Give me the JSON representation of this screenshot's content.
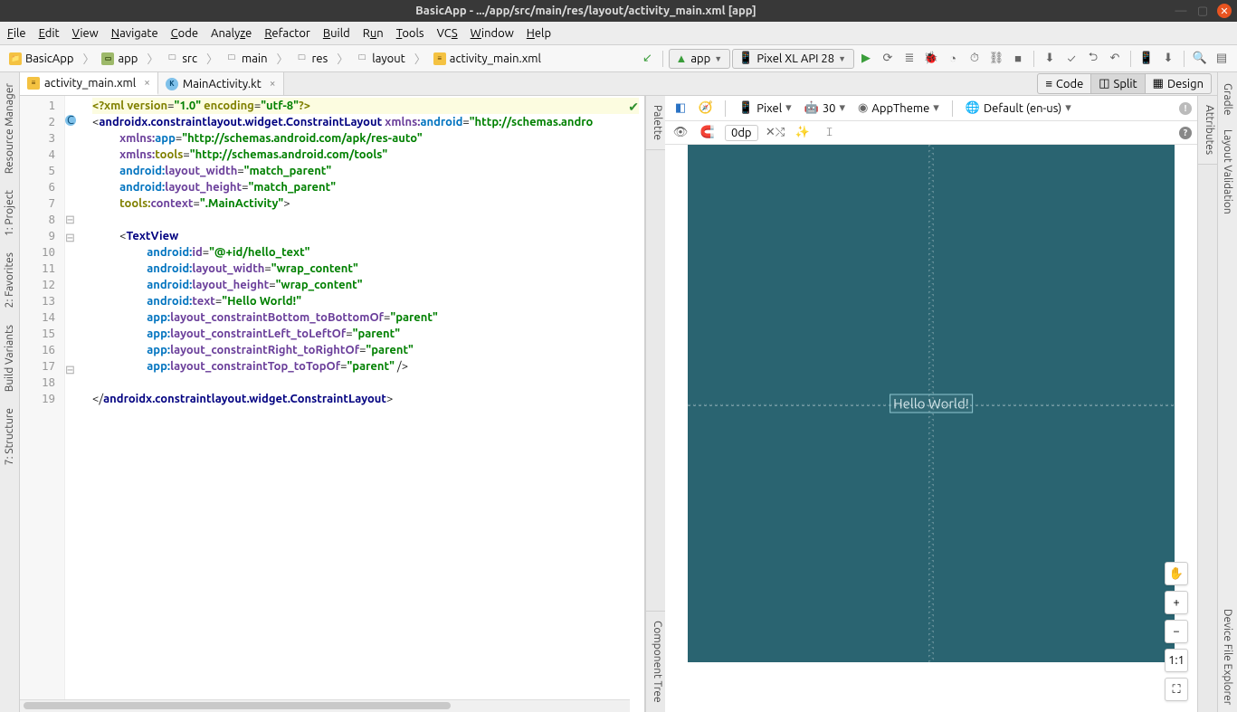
{
  "window": {
    "title": "BasicApp - .../app/src/main/res/layout/activity_main.xml [app]"
  },
  "menu": [
    "File",
    "Edit",
    "View",
    "Navigate",
    "Code",
    "Analyze",
    "Refactor",
    "Build",
    "Run",
    "Tools",
    "VCS",
    "Window",
    "Help"
  ],
  "breadcrumbs": [
    "BasicApp",
    "app",
    "src",
    "main",
    "res",
    "layout",
    "activity_main.xml"
  ],
  "run": {
    "config": "app",
    "device": "Pixel XL API 28"
  },
  "tabs": [
    {
      "label": "activity_main.xml",
      "icon": "xml",
      "active": true
    },
    {
      "label": "MainActivity.kt",
      "icon": "kt",
      "active": false
    }
  ],
  "view_modes": {
    "code": "Code",
    "split": "Split",
    "design": "Design",
    "active": "Split"
  },
  "left_tools": [
    "Resource Manager",
    "1: Project",
    "2: Favorites",
    "Build Variants",
    "7: Structure"
  ],
  "right_tools": [
    "Gradle",
    "Layout Validation",
    "Device File Explorer"
  ],
  "side_tabs": {
    "palette": "Palette",
    "component_tree": "Component Tree",
    "attributes": "Attributes"
  },
  "preview_toolbar": {
    "device": "Pixel",
    "api": "30",
    "theme": "AppTheme",
    "locale": "Default (en-us)",
    "margin": "0dp"
  },
  "preview_text": "Hello World!",
  "zoom_labels": {
    "plus": "+",
    "minus": "−",
    "one": "1:1",
    "fit": "⛶"
  },
  "code_lines": 19,
  "code": {
    "l1": {
      "a": "<?",
      "b": "xml version",
      "c": "=",
      "d": "\"1.0\"",
      "e": " encoding",
      "f": "=",
      "g": "\"utf-8\"",
      "h": "?>"
    },
    "l2": {
      "a": "<",
      "b": "androidx.constraintlayout.widget.ConstraintLayout",
      "c": " xmlns:",
      "d": "android",
      "e": "=",
      "f": "\"http://schemas.andro"
    },
    "l3": {
      "a": "xmlns:",
      "b": "app",
      "c": "=",
      "d": "\"http://schemas.android.com/apk/res-auto\""
    },
    "l4": {
      "a": "xmlns:",
      "b": "tools",
      "c": "=",
      "d": "\"http://schemas.android.com/tools\""
    },
    "l5": {
      "a": "android:",
      "b": "layout_width",
      "c": "=",
      "d": "\"match_parent\""
    },
    "l6": {
      "a": "android:",
      "b": "layout_height",
      "c": "=",
      "d": "\"match_parent\""
    },
    "l7": {
      "a": "tools:",
      "b": "context",
      "c": "=",
      "d": "\".MainActivity\"",
      "e": ">"
    },
    "l9": {
      "a": "<",
      "b": "TextView"
    },
    "l10": {
      "a": "android:",
      "b": "id",
      "c": "=",
      "d": "\"@+id/hello_text\""
    },
    "l11": {
      "a": "android:",
      "b": "layout_width",
      "c": "=",
      "d": "\"wrap_content\""
    },
    "l12": {
      "a": "android:",
      "b": "layout_height",
      "c": "=",
      "d": "\"wrap_content\""
    },
    "l13": {
      "a": "android:",
      "b": "text",
      "c": "=",
      "d": "\"Hello World!\""
    },
    "l14": {
      "a": "app:",
      "b": "layout_constraintBottom_toBottomOf",
      "c": "=",
      "d": "\"parent\""
    },
    "l15": {
      "a": "app:",
      "b": "layout_constraintLeft_toLeftOf",
      "c": "=",
      "d": "\"parent\""
    },
    "l16": {
      "a": "app:",
      "b": "layout_constraintRight_toRightOf",
      "c": "=",
      "d": "\"parent\""
    },
    "l17": {
      "a": "app:",
      "b": "layout_constraintTop_toTopOf",
      "c": "=",
      "d": "\"parent\"",
      "e": " />"
    },
    "l19": {
      "a": "</",
      "b": "androidx.constraintlayout.widget.ConstraintLayout",
      "c": ">"
    }
  }
}
